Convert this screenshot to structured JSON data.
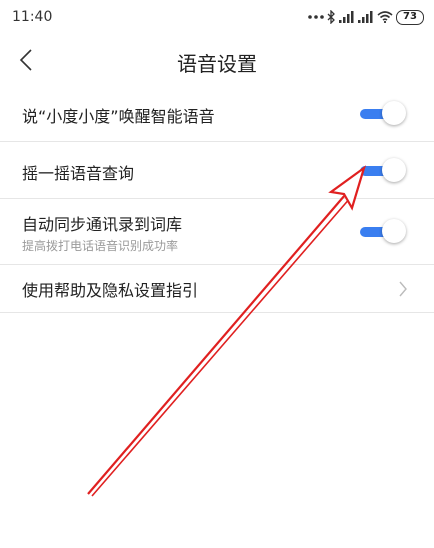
{
  "status_bar": {
    "time": "11:40",
    "icons": [
      "dots-icon",
      "bluetooth-icon",
      "signal-icon",
      "signal-icon",
      "wifi-icon"
    ],
    "battery": "73"
  },
  "header": {
    "title": "语音设置",
    "back_icon": "chevron-left-icon"
  },
  "settings": [
    {
      "label": "说“小度小度”唤醒智能语音",
      "toggle": true
    },
    {
      "label": "摇一摇语音查询",
      "toggle": true
    },
    {
      "label": "自动同步通讯录到词库",
      "sublabel": "提高拨打电话语音识别成功率",
      "toggle": true
    },
    {
      "label": "使用帮助及隐私设置指引",
      "chevron": true
    }
  ],
  "colors": {
    "accent": "#3a7ef0",
    "annotation_arrow": "#e02020",
    "divider": "#e6e6e6"
  }
}
